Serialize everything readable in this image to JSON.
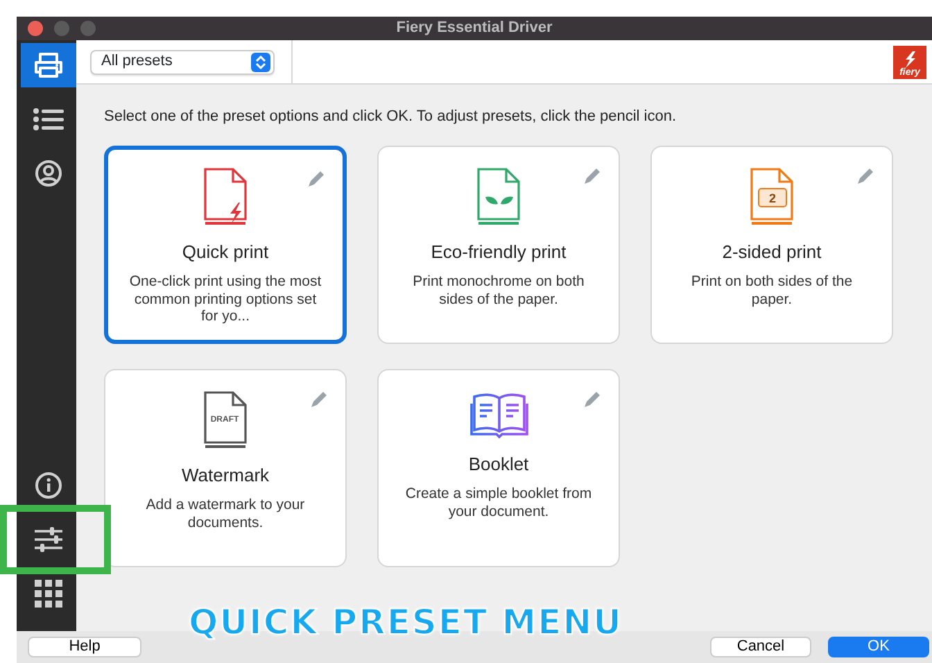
{
  "window": {
    "title": "Fiery Essential Driver"
  },
  "sidebar": {
    "items": [
      {
        "selected": true,
        "highlighted": false
      },
      {
        "selected": false,
        "highlighted": false
      },
      {
        "selected": false,
        "highlighted": false
      },
      {
        "selected": false,
        "highlighted": false
      },
      {
        "selected": false,
        "highlighted": true
      },
      {
        "selected": false,
        "highlighted": false
      }
    ]
  },
  "toolbar": {
    "preset_dropdown": "All presets",
    "logo_text": "fiery"
  },
  "instruction": "Select one of the preset options and click OK. To adjust presets, click the pencil icon.",
  "presets": [
    {
      "kind": "quick",
      "title": "Quick print",
      "description": "One-click print using the most common printing options set for yo...",
      "selected": true
    },
    {
      "kind": "eco",
      "title": "Eco-friendly print",
      "description": "Print monochrome on both sides of the paper.",
      "selected": false
    },
    {
      "kind": "duplex",
      "title": "2-sided print",
      "description": "Print on both sides of the paper.",
      "icon_text": "2",
      "selected": false
    },
    {
      "kind": "watermark",
      "title": "Watermark",
      "description": "Add a watermark to your documents.",
      "icon_text": "DRAFT",
      "selected": false
    },
    {
      "kind": "booklet",
      "title": "Booklet",
      "description": "Create a simple booklet from your document.",
      "selected": false
    }
  ],
  "footer": {
    "help": "Help",
    "cancel": "Cancel",
    "ok": "OK"
  },
  "annotation": {
    "caption": "QUICK PRESET MENU"
  }
}
